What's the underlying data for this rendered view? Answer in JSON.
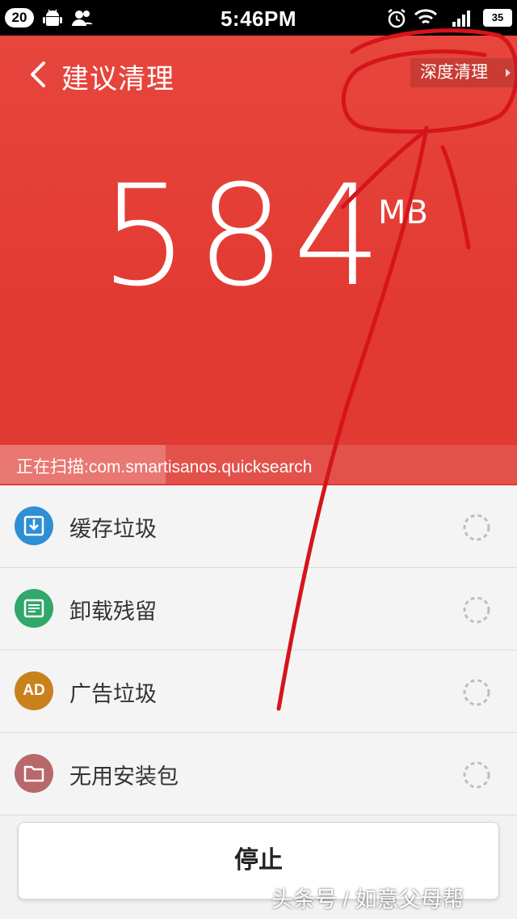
{
  "status_bar": {
    "notification_count": "20",
    "time": "5:46PM",
    "battery": "35"
  },
  "header": {
    "title": "建议清理",
    "deep_clean_label": "深度清理"
  },
  "summary": {
    "size_value": "584",
    "size_unit": "MB",
    "scan_status": "正在扫描:com.smartisanos.quicksearch",
    "scan_progress_percent": 32
  },
  "list": {
    "items": [
      {
        "label": "缓存垃圾",
        "icon": "download-icon",
        "color": "#2f8fd6"
      },
      {
        "label": "卸载残留",
        "icon": "document-icon",
        "color": "#2fa86a"
      },
      {
        "label": "广告垃圾",
        "icon": "ad-icon",
        "icon_text": "AD",
        "color": "#c9811c"
      },
      {
        "label": "无用安装包",
        "icon": "folder-icon",
        "color": "#b8686a"
      }
    ]
  },
  "actions": {
    "stop_label": "停止"
  },
  "watermark": "头条号 / 如意父母帮",
  "colors": {
    "hero_red": "#e23a33",
    "annotation_red": "#d6141b"
  }
}
